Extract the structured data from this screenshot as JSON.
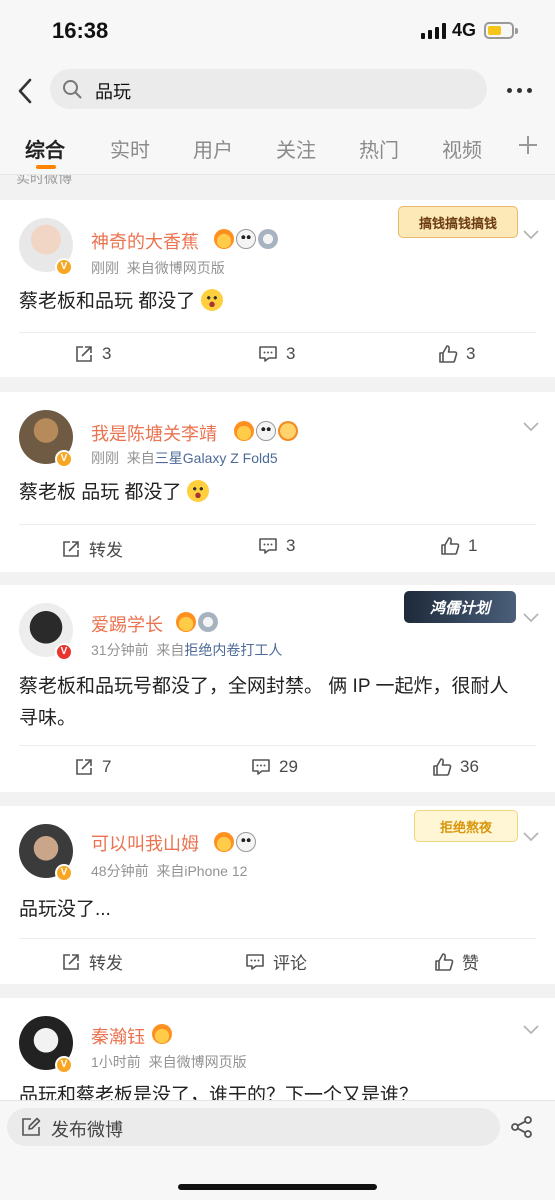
{
  "status": {
    "time": "16:38",
    "network": "4G"
  },
  "search": {
    "query": "品玩"
  },
  "tabs": [
    {
      "label": "综合",
      "active": true
    },
    {
      "label": "实时"
    },
    {
      "label": "用户"
    },
    {
      "label": "关注"
    },
    {
      "label": "热门"
    },
    {
      "label": "视频"
    }
  ],
  "section_label": "实时微博",
  "posts": [
    {
      "username": "神奇的大香蕉",
      "time": "刚刚",
      "source_prefix": "来自",
      "source": "微博网页版",
      "text": "蔡老板和品玩  都没了",
      "decoration": "搞钱搞钱搞钱",
      "actions": [
        "3",
        "3",
        "3"
      ]
    },
    {
      "username": "我是陈塘关李靖",
      "time": "刚刚",
      "source_prefix": "来自",
      "source": "三星Galaxy Z Fold5",
      "text": "蔡老板 品玩 都没了",
      "actions": [
        "转发",
        "3",
        "1"
      ]
    },
    {
      "username": "爱踢学长",
      "time": "31分钟前",
      "source_prefix": "来自",
      "source": "拒绝内卷打工人",
      "text": "蔡老板和品玩号都没了，全网封禁。 俩 IP 一起炸，很耐人寻味。",
      "decoration": "鸿儒计划",
      "actions": [
        "7",
        "29",
        "36"
      ]
    },
    {
      "username": "可以叫我山姆",
      "time": "48分钟前",
      "source_prefix": "来自",
      "source": "iPhone 12",
      "text": "品玩没了...",
      "decoration": "拒绝熬夜",
      "actions": [
        "转发",
        "评论",
        "赞"
      ]
    },
    {
      "username": "秦瀚钰",
      "time": "1小时前",
      "source_prefix": "来自",
      "source": "微博网页版",
      "text": "品玩和蔡老板是没了，谁干的？下一个又是谁？"
    }
  ],
  "compose": {
    "placeholder": "发布微博"
  },
  "colors": {
    "accent": "#ff8200",
    "username": "#eb7350",
    "source_link": "#4d6a98"
  }
}
